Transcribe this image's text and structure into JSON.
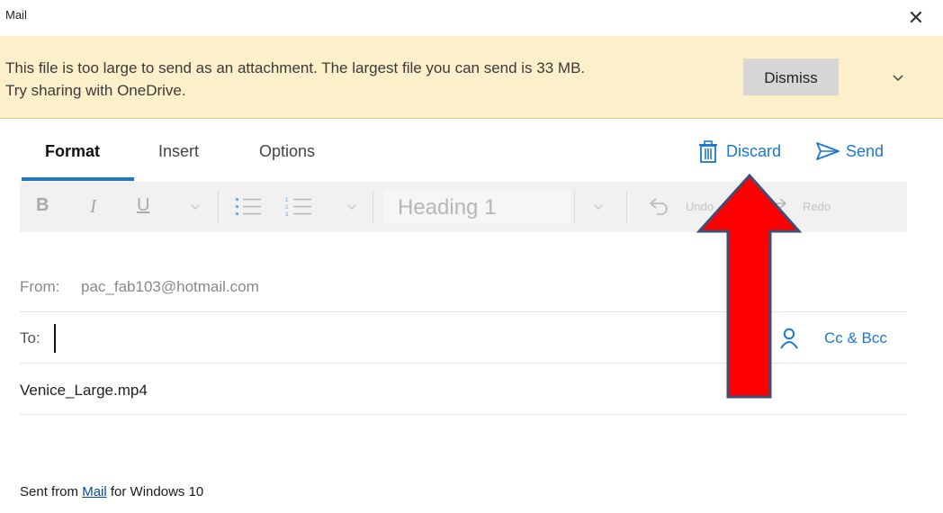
{
  "window": {
    "title": "Mail"
  },
  "banner": {
    "line1": "This file is too large to send as an attachment. The largest file you can send is 33 MB.",
    "line2": "Try sharing with OneDrive.",
    "dismiss_label": "Dismiss",
    "background": "#fcf0cb"
  },
  "tabs": [
    {
      "label": "Format",
      "active": true
    },
    {
      "label": "Insert",
      "active": false
    },
    {
      "label": "Options",
      "active": false
    }
  ],
  "actions": {
    "discard_label": "Discard",
    "send_label": "Send",
    "accent": "#1a78d0"
  },
  "toolbar": {
    "bold": "B",
    "italic": "I",
    "underline": "U",
    "style_value": "Heading 1",
    "undo_label": "Undo",
    "redo_label": "Redo"
  },
  "compose": {
    "from_label": "From:",
    "from_value": "pac_fab103@hotmail.com",
    "to_label": "To:",
    "to_value": "",
    "cc_bcc_label": "Cc & Bcc",
    "subject": "Venice_Large.mp4",
    "signature_prefix": "Sent from ",
    "signature_link": "Mail",
    "signature_suffix": " for Windows 10"
  },
  "icons": [
    "close-icon",
    "chevron-down-icon",
    "trash-icon",
    "send-icon",
    "person-icon",
    "bullet-list-icon",
    "numbered-list-icon",
    "undo-icon",
    "redo-icon"
  ],
  "annotation": {
    "arrow_color": "#ff0000"
  }
}
